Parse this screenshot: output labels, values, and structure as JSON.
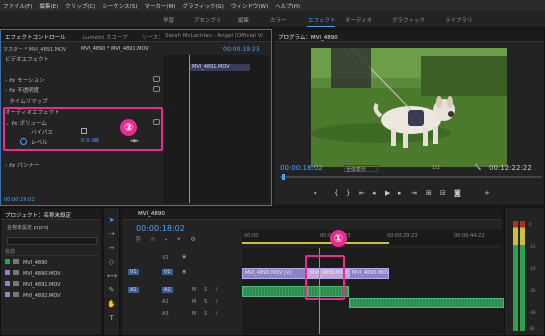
{
  "menu": [
    "ファイル(F)",
    "編集(E)",
    "クリップ(C)",
    "シーケンス(S)",
    "マーカー(M)",
    "グラフィック(G)",
    "ウィンドウ(W)",
    "ヘルプ(H)"
  ],
  "workspaces": [
    "学習",
    "アセンブリ",
    "編集",
    "カラー",
    "エフェクト",
    "オーディオ",
    "グラフィック",
    "ライブラリ"
  ],
  "effect_controls": {
    "tab_active": "エフェクトコントロール",
    "tab_lumetri": "Lumetri スコープ",
    "tab_source": "ソース：",
    "tab_source_name": "Sarah McLachlan - Angel (Official Vi",
    "master": "マスター * MVI_4891.MOV",
    "master_clip": "MVI_4890 * MVI_4891.MOV",
    "timecode_top": "00:00:19:23",
    "clip_label": "MVI_4891.MOV",
    "video_effects": "ビデオエフェクト",
    "motion": "モーション",
    "opacity": "不透明度",
    "time_remap": "タイムリマップ",
    "audio_effects": "オーディオエフェクト",
    "volume": "ボリューム",
    "bypass": "バイパス",
    "level": "レベル",
    "level_value": "0.0 dB",
    "panner": "パンナー",
    "bottom_timecode": "00:00:19:02"
  },
  "program": {
    "title": "プログラム：MVI_4890",
    "timecode": "00:00:18:02",
    "zoom": "全体表示",
    "quality": "1/2",
    "duration": "00:12:22:22"
  },
  "project": {
    "tab": "プロジェクト：名称未設定",
    "tab2": "名称未設定.prproj",
    "search_placeholder": "",
    "name_header": "名前",
    "items": [
      "MVI_4890",
      "MVI_4890.MOV",
      "MVI_4891.MOV",
      "MVI_4892.MOV"
    ]
  },
  "timeline": {
    "tab": "MVI_4890",
    "timecode": "00:00:18:02",
    "ruler": [
      "00:00",
      "00:00:14:23",
      "00:00:29:23",
      "00:00:44:22"
    ],
    "tracks": [
      "V2",
      "V1",
      "A1",
      "A2",
      "A3"
    ],
    "video_clips": [
      "MVI_4890.MOV [V]",
      "MVI_4890.MOV [V]",
      "MVI_4890.MOV [V]"
    ],
    "audio_clips": [
      "",
      "",
      ""
    ]
  },
  "meter": {
    "scale": [
      "0",
      "-12",
      "-24",
      "-36",
      "-48",
      "dB"
    ]
  },
  "annotations": {
    "one": "①",
    "two": "②"
  },
  "colors": {
    "accent": "#4aa3ff",
    "video_clip": "#8b83c8",
    "audio_clip": "#2f8a52",
    "highlight": "#ea2a8e"
  }
}
